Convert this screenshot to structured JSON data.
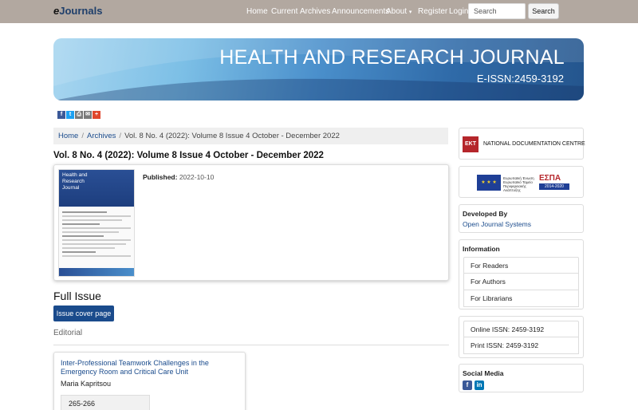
{
  "nav": {
    "logo_prefix": "e",
    "logo_text": "Journals",
    "links": [
      "Home",
      "Current",
      "Archives",
      "Announcements",
      "About",
      "Register",
      "Login"
    ],
    "about_caret": "▾",
    "search_placeholder": "Search",
    "search_button": "Search"
  },
  "banner": {
    "title": "HEALTH AND RESEARCH JOURNAL",
    "issn": "E-ISSN:2459-3192"
  },
  "share": {
    "icons": [
      "facebook-icon",
      "twitter-icon",
      "print-icon",
      "email-icon",
      "plus-icon"
    ],
    "glyphs": [
      "f",
      "t",
      "⎙",
      "✉",
      "+"
    ],
    "colors": [
      "#3b5998",
      "#1da1f2",
      "#7a7a7a",
      "#7a7a7a",
      "#e0472d"
    ]
  },
  "breadcrumb": {
    "home": "Home",
    "archives": "Archives",
    "separator": "/",
    "current": "Vol. 8 No. 4 (2022): Volume 8 Issue 4 October - December 2022"
  },
  "issue": {
    "title": "Vol. 8 No. 4 (2022): Volume 8 Issue 4 October - December 2022",
    "published_label": "Published:",
    "published_date": "2022-10-10",
    "cover": {
      "line1": "Health and",
      "line2": "Research",
      "line3": "Journal"
    }
  },
  "full_issue": {
    "heading": "Full Issue",
    "cover_button": "Issue cover page"
  },
  "section": {
    "name": "Editorial"
  },
  "articles": [
    {
      "title": "Inter-Professional Teamwork Challenges in the Emergency Room and Critical Care Unit",
      "author": "Maria Kapritsou",
      "pages": "265-266"
    }
  ],
  "sidebar": {
    "ekt_logo": "EKT",
    "ekt_name": "NATIONAL DOCUMENTATION CENTRE",
    "espa_eu_text": "★ ★ ★",
    "espa_caption": "Ευρωπαϊκή Ένωση Ευρωπαϊκό Ταμείο Περιφερειακής Ανάπτυξης",
    "espa_logo": "ΕΣΠΑ",
    "espa_years": "2014-2020",
    "developed_by_title": "Developed By",
    "developed_by_link": "Open Journal Systems",
    "information_title": "Information",
    "information_links": [
      "For Readers",
      "For Authors",
      "For Librarians"
    ],
    "issn_rows": [
      "Online ISSN: 2459-3192",
      "Print ISSN: 2459-3192"
    ],
    "social_title": "Social Media",
    "social_icons": [
      "facebook-icon",
      "linkedin-icon"
    ],
    "social_glyphs": [
      "f",
      "in"
    ],
    "social_colors": [
      "#3b5998",
      "#0077b5"
    ]
  }
}
